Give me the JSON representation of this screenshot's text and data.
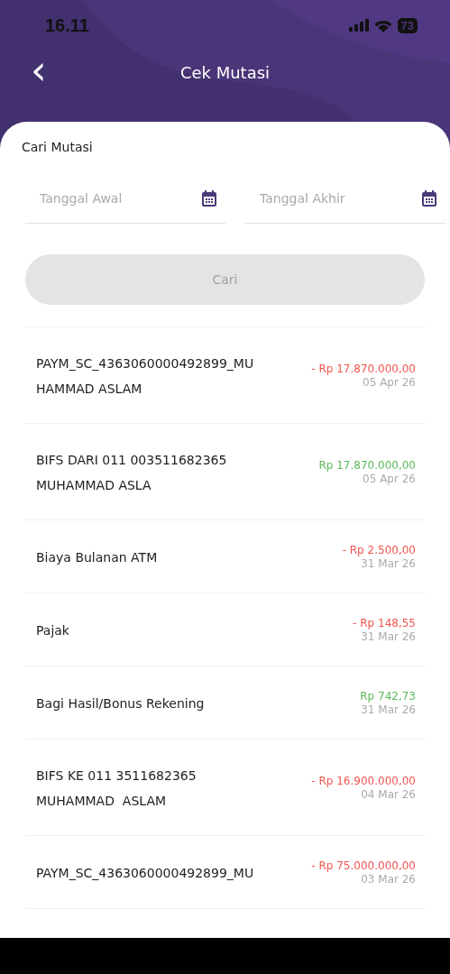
{
  "status_bar": {
    "time": "16.11",
    "battery": "73"
  },
  "header": {
    "back": "‹",
    "title": "Cek Mutasi"
  },
  "search": {
    "title": "Cari Mutasi",
    "fields": [
      {
        "placeholder": "Tanggal Awal"
      },
      {
        "placeholder": "Tanggal Akhir"
      }
    ],
    "button": {
      "label": "Cari",
      "disabled": true
    }
  },
  "transactions": [
    {
      "lines": [
        "PAYM_SC_4363060000492899_MU",
        "HAMMAD ASLAM"
      ],
      "amount": "- Rp 17.870.000,00",
      "date": "05 Apr 26",
      "kind": "debit"
    },
    {
      "lines": [
        "BIFS DARI 011 003511682365",
        "MUHAMMAD ASLA"
      ],
      "amount": "Rp 17.870.000,00",
      "date": "05 Apr 26",
      "kind": "credit"
    },
    {
      "lines": [
        "Biaya Bulanan ATM"
      ],
      "amount": "- Rp 2.500,00",
      "date": "31 Mar 26",
      "kind": "debit"
    },
    {
      "lines": [
        "Pajak"
      ],
      "amount": "- Rp 148,55",
      "date": "31 Mar 26",
      "kind": "debit"
    },
    {
      "lines": [
        "Bagi Hasil/Bonus Rekening"
      ],
      "amount": "Rp 742,73",
      "date": "31 Mar 26",
      "kind": "credit"
    },
    {
      "lines": [
        "BIFS KE 011 3511682365",
        "MUHAMMAD  ASLAM"
      ],
      "amount": "- Rp 16.900.000,00",
      "date": "04 Mar 26",
      "kind": "debit"
    },
    {
      "lines": [
        "PAYM_SC_4363060000492899_MU"
      ],
      "amount": "- Rp 75.000.000,00",
      "date": "03 Mar 26",
      "kind": "debit"
    }
  ]
}
